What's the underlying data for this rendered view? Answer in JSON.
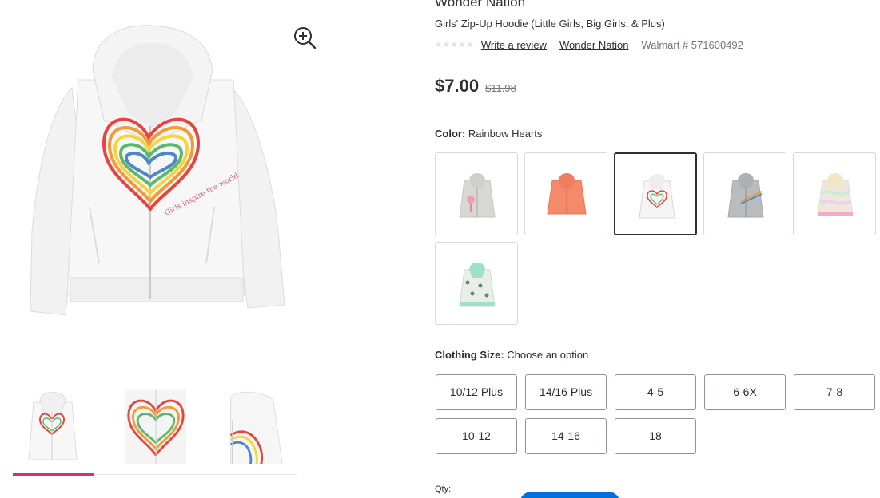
{
  "product": {
    "brand_title": "Wonder Nation",
    "title": "Girls' Zip-Up Hoodie (Little Girls, Big Girls, & Plus)",
    "rating_stars": "★★★★★",
    "write_review_label": "Write a review",
    "brand_link": "Wonder Nation",
    "item_number": "Walmart # 571600492",
    "price": "$7.00",
    "was_price": "$11.98"
  },
  "color": {
    "label": "Color:",
    "selected": "Rainbow Hearts",
    "swatches": [
      {
        "icon": "flamingo-hoodie",
        "color": "#d7d7d4"
      },
      {
        "icon": "coral-hoodie",
        "color": "#f48a6a"
      },
      {
        "icon": "rainbow-heart-hoodie",
        "color": "#f5f5f5"
      },
      {
        "icon": "gray-rainbow-hoodie",
        "color": "#b9bcbe"
      },
      {
        "icon": "pastel-tiedye-hoodie",
        "color": "#efe7d9"
      },
      {
        "icon": "mint-print-hoodie",
        "color": "#9fe0c8"
      }
    ]
  },
  "size": {
    "label": "Clothing Size:",
    "selected": "Choose an option",
    "options": [
      "10/12 Plus",
      "14/16 Plus",
      "4-5",
      "6-6X",
      "7-8",
      "10-12",
      "14-16",
      "18"
    ]
  },
  "qty_label": "Qty:",
  "colors": {
    "accent_pink": "#c7357e",
    "primary_blue": "#0071dc",
    "text": "#2e2f32",
    "muted": "#74767c"
  }
}
